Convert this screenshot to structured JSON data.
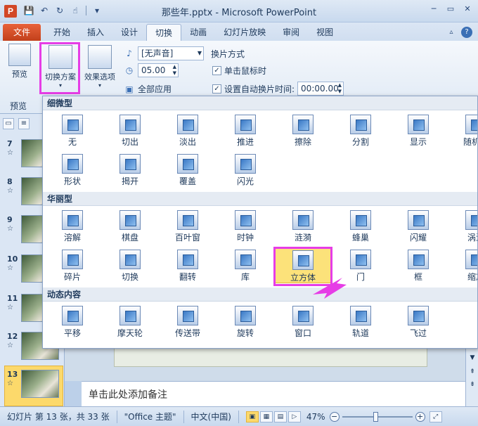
{
  "app_icon": "P",
  "title": "那些年.pptx - Microsoft PowerPoint",
  "qat": {
    "save_icon": "save-icon",
    "undo_icon": "undo-icon",
    "redo_icon": "redo-icon",
    "touch_icon": "touch-icon",
    "customize_icon": "customize-icon"
  },
  "window": {
    "minimize": "─",
    "restore": "▭",
    "close": "✕"
  },
  "tabs": {
    "file": "文件",
    "items": [
      {
        "label": "开始"
      },
      {
        "label": "插入"
      },
      {
        "label": "设计"
      },
      {
        "label": "切换"
      },
      {
        "label": "动画"
      },
      {
        "label": "幻灯片放映"
      },
      {
        "label": "审阅"
      },
      {
        "label": "视图"
      }
    ]
  },
  "ribbon": {
    "preview_label": "预览",
    "preview_group": "预览",
    "transition_scheme": "切换方案",
    "effect_options": "效果选项",
    "sound_value": "[无声音]",
    "duration_value": "05.00",
    "apply_all": "全部应用",
    "advance_title": "换片方式",
    "on_click": "单击鼠标时",
    "auto_after": "设置自动换片时间:",
    "auto_time": "00:00.00",
    "check_mark": "✓"
  },
  "gallery": {
    "sections": [
      {
        "title": "细微型"
      },
      {
        "title": "华丽型"
      },
      {
        "title": "动态内容"
      }
    ],
    "subtle": [
      "无",
      "切出",
      "淡出",
      "推进",
      "擦除",
      "分割",
      "显示",
      "随机线",
      "形状",
      "揭开",
      "覆盖",
      "闪光"
    ],
    "exciting": [
      "溶解",
      "棋盘",
      "百叶窗",
      "时钟",
      "涟漪",
      "蜂巢",
      "闪耀",
      "涡流",
      "碎片",
      "切换",
      "翻转",
      "库",
      "立方体",
      "门",
      "框",
      "缩放"
    ],
    "dynamic": [
      "平移",
      "摩天轮",
      "传送带",
      "旋转",
      "窗口",
      "轨道",
      "飞过"
    ],
    "selected": "立方体"
  },
  "slides": [
    {
      "num": "7"
    },
    {
      "num": "8"
    },
    {
      "num": "9"
    },
    {
      "num": "10"
    },
    {
      "num": "11"
    },
    {
      "num": "12"
    },
    {
      "num": "13"
    }
  ],
  "slide_star": "☆",
  "notes_placeholder": "单击此处添加备注",
  "status": {
    "slide_info": "幻灯片 第 13 张，共 33 张",
    "theme": "\"Office 主题\"",
    "language": "中文(中国)",
    "zoom": "47%",
    "zoom_level": 0.47
  },
  "colors": {
    "accent": "#e63de6",
    "file_tab": "#c2401b",
    "selected": "#fce27a"
  }
}
